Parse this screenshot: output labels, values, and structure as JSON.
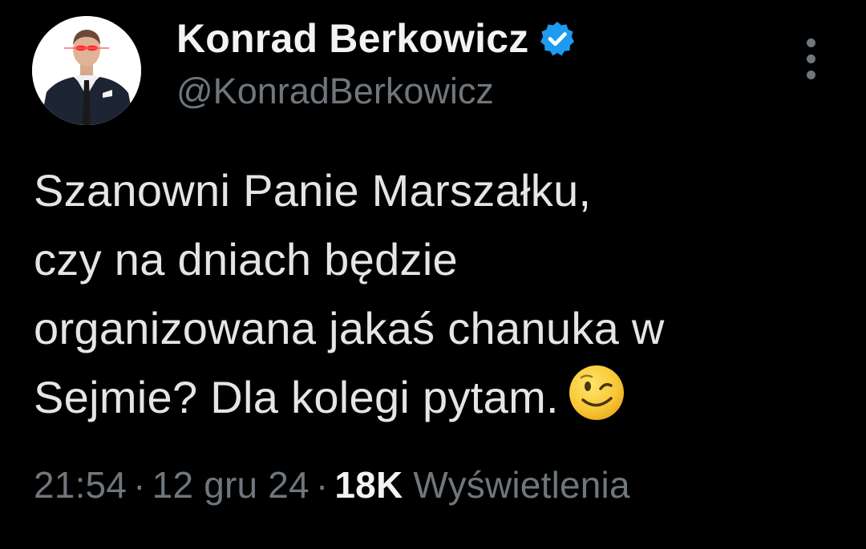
{
  "author": {
    "display_name": "Konrad Berkowicz",
    "handle": "@KonradBerkowicz",
    "verified_icon": "verified-badge-icon",
    "avatar_icon": "profile-photo"
  },
  "menu": {
    "icon": "more-vertical-icon"
  },
  "tweet": {
    "lines": [
      "Szanowni Panie Marszałku,",
      "czy na dniach będzie",
      "organizowana jakaś chanuka w",
      "Sejmie? Dla kolegi pytam."
    ],
    "emoji": "winking-face-emoji"
  },
  "meta": {
    "time": "21:54",
    "separator": "·",
    "date": "12 gru 24",
    "views_count": "18K",
    "views_label": "Wyświetlenia"
  },
  "colors": {
    "background": "#000000",
    "primary_text": "#e7e9ea",
    "secondary_text": "#6f767c",
    "verified_blue": "#1d9bf0"
  }
}
